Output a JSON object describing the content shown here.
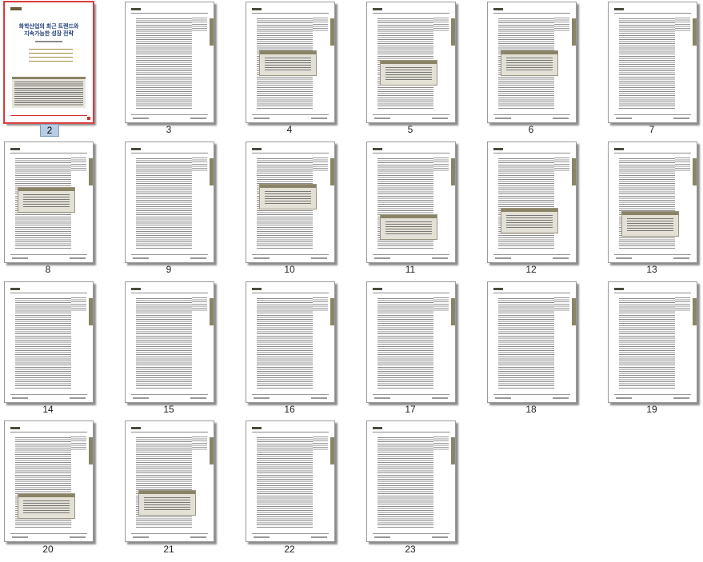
{
  "viewer": {
    "selected_page": "2",
    "cover": {
      "title_line1": "화학산업의 최근 트렌드와",
      "title_line2": "지속가능한 성장 전략"
    },
    "pages": [
      "2",
      "3",
      "4",
      "5",
      "6",
      "7",
      "8",
      "9",
      "10",
      "11",
      "12",
      "13",
      "14",
      "15",
      "16",
      "17",
      "18",
      "19",
      "20",
      "21",
      "22",
      "23"
    ]
  }
}
